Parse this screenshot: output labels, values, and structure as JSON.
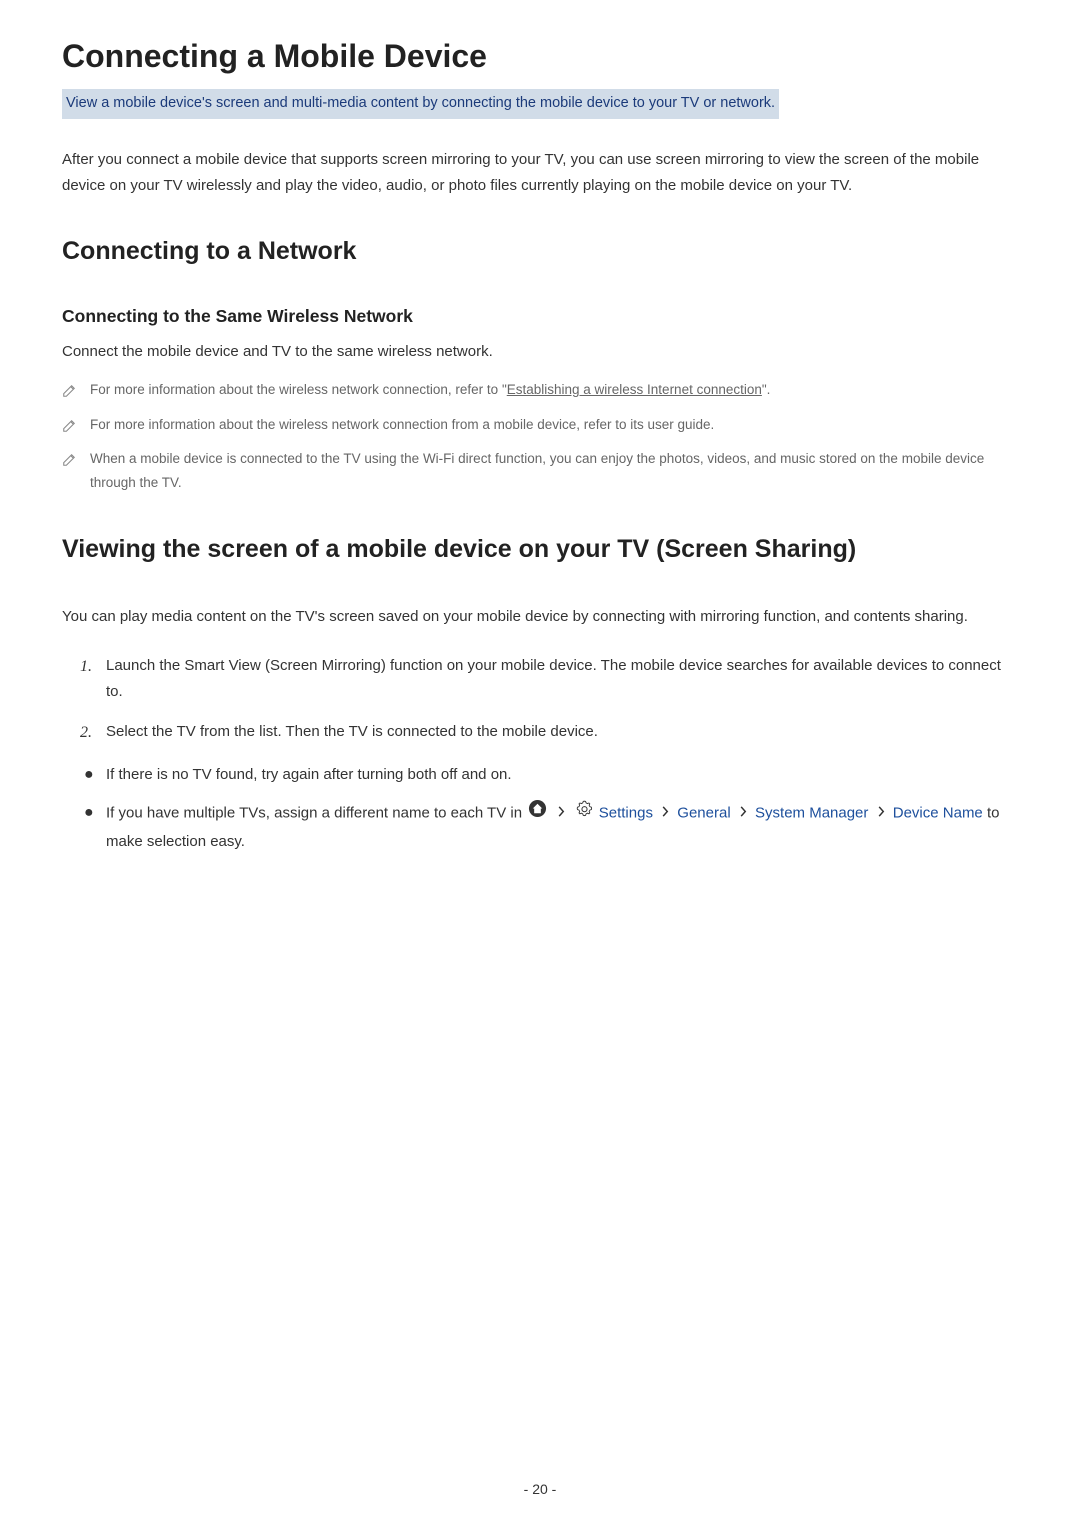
{
  "page": {
    "title": "Connecting a Mobile Device",
    "subtitle": "View a mobile device's screen and multi-media content by connecting the mobile device to your TV or network.",
    "intro": "After you connect a mobile device that supports screen mirroring to your TV, you can use screen mirroring to view the screen of the mobile device on your TV wirelessly and play the video, audio, or photo files currently playing on the mobile device on your TV.",
    "section1": {
      "heading": "Connecting to a Network",
      "subheading": "Connecting to the Same Wireless Network",
      "subtext": "Connect the mobile device and TV to the same wireless network.",
      "notes": [
        {
          "prefix": "For more information about the wireless network connection, refer to \"",
          "link": "Establishing a wireless Internet connection",
          "suffix": "\"."
        },
        {
          "text": "For more information about the wireless network connection from a mobile device, refer to its user guide."
        },
        {
          "text": "When a mobile device is connected to the TV using the Wi-Fi direct function, you can enjoy the photos, videos, and music stored on the mobile device through the TV."
        }
      ]
    },
    "section2": {
      "heading": "Viewing the screen of a mobile device on your TV (Screen Sharing)",
      "intro": "You can play media content on the TV's screen saved on your mobile device by connecting with mirroring function, and contents sharing.",
      "steps": [
        {
          "num": "1.",
          "text": "Launch the Smart View (Screen Mirroring) function on your mobile device. The mobile device searches for available devices to connect to."
        },
        {
          "num": "2.",
          "text": "Select the TV from the list. Then the TV is connected to the mobile device."
        }
      ],
      "bullets": [
        {
          "text": "If there is no TV found, try again after turning both off and on."
        },
        {
          "prefix": "If you have multiple TVs, assign a different name to each TV in ",
          "nav": {
            "settings": "Settings",
            "general": "General",
            "system_manager": "System Manager",
            "device_name": "Device Name"
          },
          "suffix": " to make selection easy."
        }
      ]
    },
    "page_number": "- 20 -"
  }
}
